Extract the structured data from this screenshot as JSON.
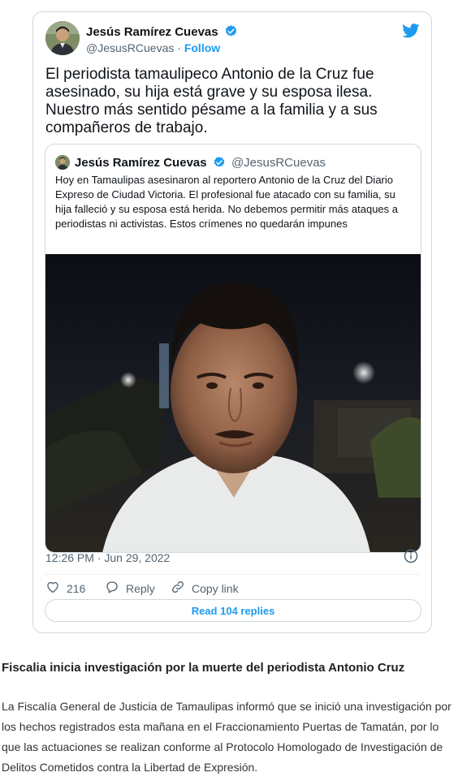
{
  "tweet": {
    "author_name": "Jesús Ramírez Cuevas",
    "author_handle": "@JesusRCuevas",
    "separator": " · ",
    "follow_label": "Follow",
    "text": "El periodista tamaulipeco Antonio de la Cruz fue asesinado, su hija está grave y su esposa ilesa. Nuestro más sentido pésame a la familia y a sus compañeros de trabajo.",
    "timestamp": "12:26 PM · Jun 29, 2022",
    "likes": "216",
    "reply_label": "Reply",
    "copy_link_label": "Copy link",
    "read_replies_label": "Read 104 replies"
  },
  "quoted_tweet": {
    "author_name": "Jesús Ramírez Cuevas",
    "author_handle": "@JesusRCuevas",
    "text": "Hoy en Tamaulipas asesinaron al reportero Antonio de la Cruz del Diario Expreso de Ciudad Victoria. El profesional fue atacado con su familia, su hija falleció y su esposa está herida. No debemos permitir más ataques a periodistas ni activistas. Estos crímenes no quedarán impunes"
  },
  "article": {
    "headline": "Fiscalia inicia investigación por la muerte del periodista Antonio Cruz",
    "body": "La Fiscalía General de Justicia de Tamaulipas informó que se inició una investigación por los hechos registrados esta mañana en el Fraccionamiento Puertas de Tamatán, por lo que las actuaciones se realizan conforme al Protocolo Homologado de Investigación de Delitos Cometidos contra la Libertad de Expresión."
  },
  "icons": {
    "verified": "verified-badge-icon",
    "bird": "twitter-bird-icon",
    "info": "info-icon",
    "like": "heart-icon",
    "reply": "reply-bubble-icon",
    "copy_link": "link-icon"
  },
  "colors": {
    "accent": "#1d9bf0",
    "text": "#0f1419",
    "secondary": "#536471",
    "border": "#cfd9de"
  }
}
